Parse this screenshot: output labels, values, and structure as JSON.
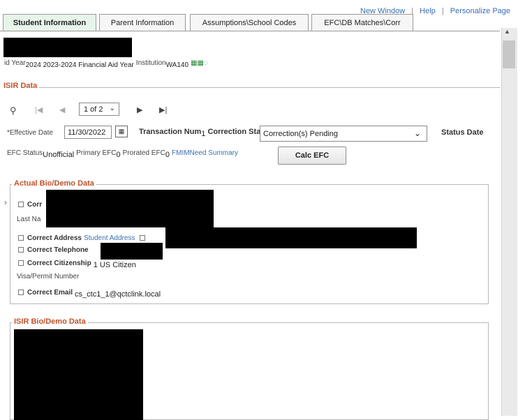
{
  "top_links": {
    "new_window": "New Window",
    "help": "Help",
    "personalize": "Personalize Page",
    "separator": "|"
  },
  "tabs": [
    {
      "label": "Student Information"
    },
    {
      "label": "Parent Information"
    },
    {
      "label": "Assumptions\\School Codes"
    },
    {
      "label": "EFC\\DB Matches\\Corr"
    }
  ],
  "aid_info": {
    "aid_year_label": "id Year",
    "aid_year_value": "2024 2023-2024 Financial Aid Year",
    "institution_label": "Institution",
    "institution_value": "WA140"
  },
  "isir": {
    "title": "ISIR Data",
    "pager": "1 of 2",
    "effective_date_label": "*Effective Date",
    "effective_date_value": "11/30/2022",
    "transaction_label": "Transaction Num",
    "transaction_value": "1",
    "correction_status_label": "Correction Status",
    "correction_status_value": "Correction(s) Pending",
    "status_date_label": "Status Date",
    "efc_status_label": "EFC Status",
    "efc_status_value": "Unofficial",
    "primary_efc_label": "Primary EFC",
    "primary_efc_value": "0",
    "prorated_efc_label": "Prorated EFC",
    "prorated_efc_value": "0",
    "fm_link": "FMIMNeed Summary",
    "calc_button": "Calc EFC"
  },
  "actual_bio": {
    "title": "Actual Bio/Demo Data",
    "correct_name_partial": "Corr",
    "last_name_partial": "Last Na",
    "correct_address": "Correct Address",
    "student_address_link": "Student Address",
    "correct_telephone": "Correct Telephone",
    "correct_citizenship": "Correct Citizenship",
    "citizenship_value": "1 US Citizen",
    "visa_label": "Visa/Permit Number",
    "correct_email": "Correct Email",
    "email_value": "cs_ctc1_1@qctclink.local"
  },
  "isir_bio": {
    "title": "ISIR Bio/Demo Data"
  },
  "icons": {
    "search": "search-icon",
    "first": "first-page-icon",
    "prev": "previous-page-icon",
    "next": "next-page-icon",
    "last": "last-page-icon",
    "calendar": "calendar-icon",
    "dropdown": "chevron-down-icon",
    "institution_icons": "grid-icon"
  }
}
